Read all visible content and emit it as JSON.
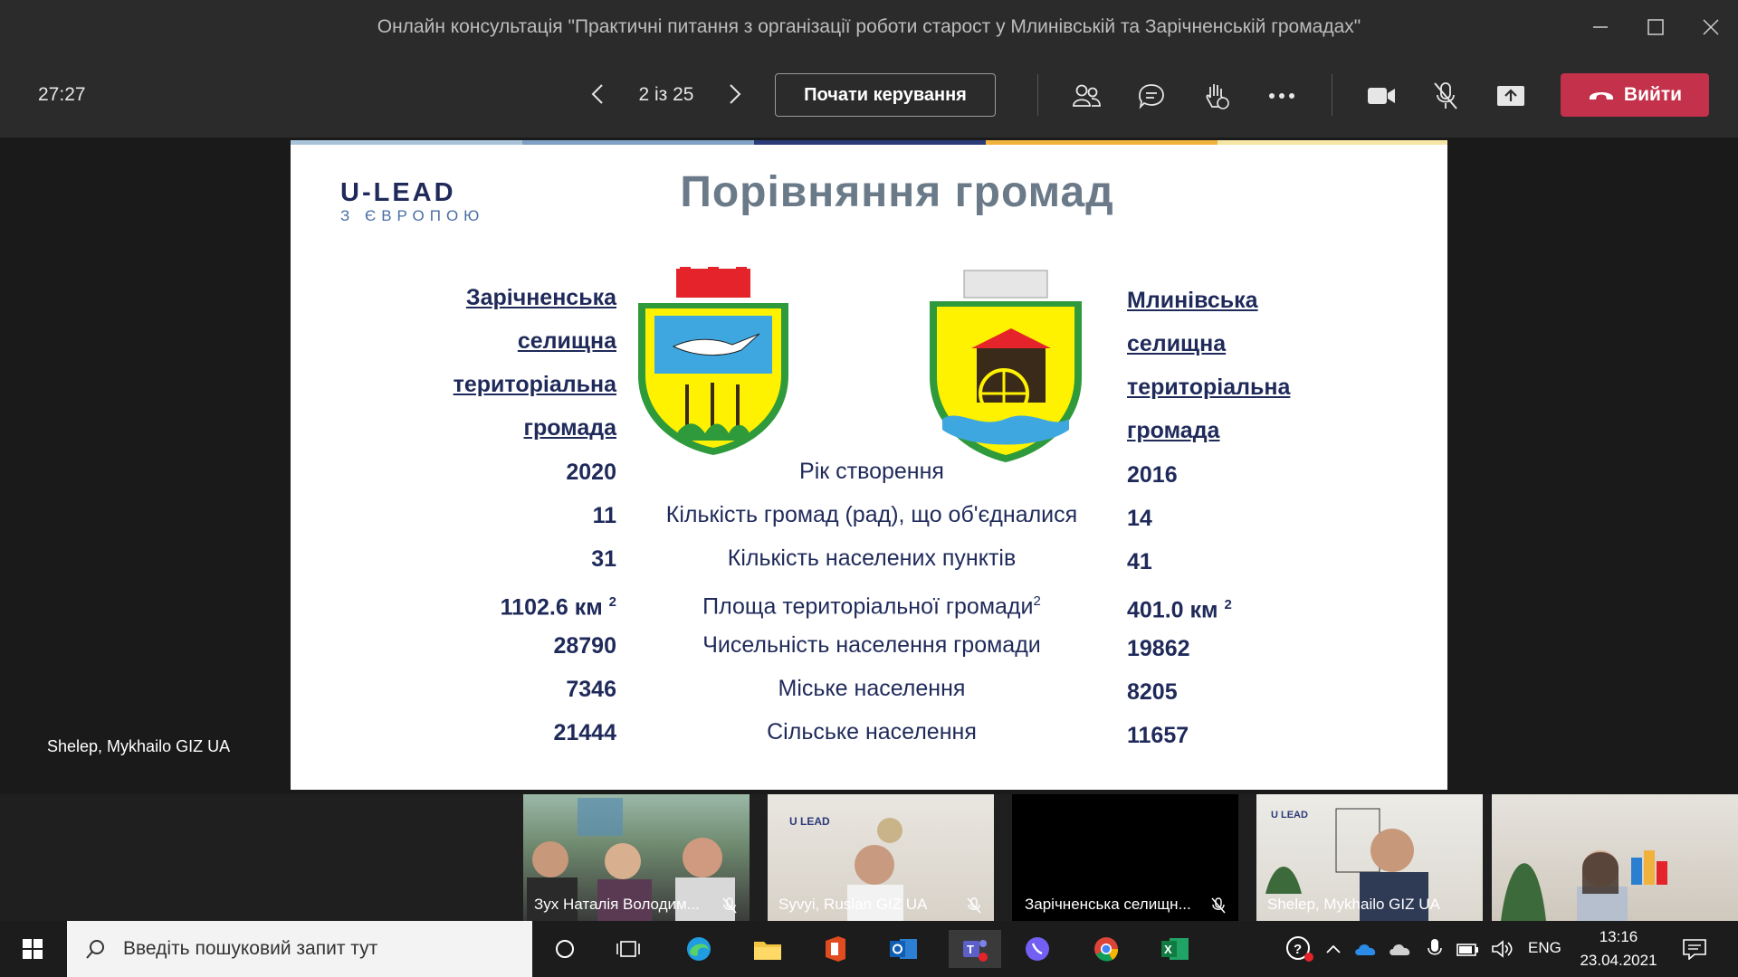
{
  "window": {
    "title": "Онлайн консультація \"Практичні питання з організації роботи старост у Млинівській та Зарічненській громадах\""
  },
  "toolbar": {
    "timer": "27:27",
    "pager": "2 із 25",
    "take_control_label": "Почати керування",
    "leave_label": "Вийти"
  },
  "presenter": {
    "name": "Shelep, Mykhailo GIZ UA"
  },
  "slide": {
    "logo_main": "U-LEAD",
    "logo_sub": "З ЄВРОПОЮ",
    "title": "Порівняння громад",
    "left_community": [
      "Зарічненська",
      "селищна",
      "територіальна",
      "громада"
    ],
    "right_community": [
      "Млинівська",
      "селищна",
      "територіальна",
      "громада"
    ],
    "rows": [
      {
        "label": "Рік створення",
        "left": "2020",
        "right": "2016"
      },
      {
        "label": "Кількість громад (рад), що об'єдналися",
        "left": "11",
        "right": "14"
      },
      {
        "label": "Кількість населених пунктів",
        "left": "31",
        "right": "41"
      },
      {
        "label": "Площа територіальної громади",
        "label_sup": "2",
        "left": "1102.6 км",
        "left_sup": "2",
        "right": "401.0 км",
        "right_sup": "2"
      },
      {
        "label": "Чисельність населення громади",
        "left": "28790",
        "right": "19862"
      },
      {
        "label": "Міське населення",
        "left": "7346",
        "right": "8205"
      },
      {
        "label": "Сільське населення",
        "left": "21444",
        "right": "11657"
      }
    ]
  },
  "participants": [
    {
      "name": "Зух Наталія Володим..."
    },
    {
      "name": "Syvyi, Ruslan GIZ UA"
    },
    {
      "name": "Зарічненська селищн..."
    },
    {
      "name": "Shelep, Mykhailo GIZ UA"
    }
  ],
  "taskbar": {
    "search_placeholder": "Введіть пошуковий запит тут",
    "language": "ENG",
    "time": "13:16",
    "date": "23.04.2021"
  },
  "colors": {
    "leave": "#c4314b",
    "slide_text": "#1f2a5a",
    "title_gray": "#6b7a89"
  }
}
